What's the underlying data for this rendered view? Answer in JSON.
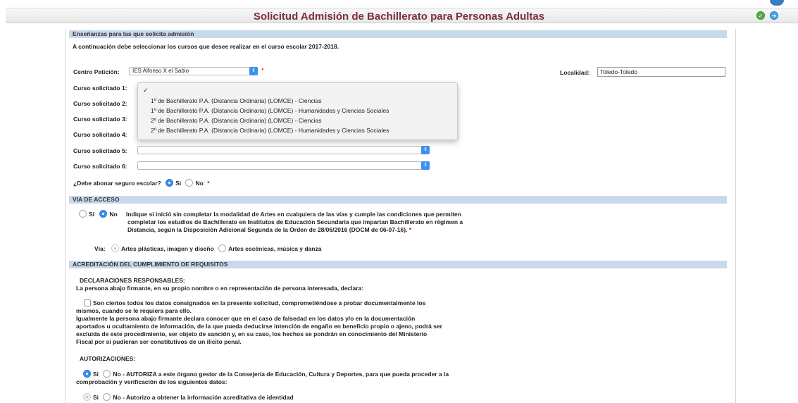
{
  "window": {
    "title": "Solicitud Admisión de Bachillerato para Personas Adultas",
    "icons": [
      "check-circle-icon",
      "arrow-circle-icon"
    ],
    "accent": "#7a2e3d"
  },
  "ensenanzas": {
    "header": "Enseñanzas para las que solicita admisión",
    "intro": "A continuación debe seleccionar los cursos que desee realizar en el curso escolar 2017-2018.",
    "centro_label": "Centro Petición:",
    "centro_value": "IES Alfonso X el Sabio",
    "required_mark": "*",
    "localidad_label": "Localidad:",
    "localidad_value": "Toledo-Toledo",
    "cursos": [
      {
        "label": "Curso solicitado 1:",
        "value": ""
      },
      {
        "label": "Curso solicitado 2:",
        "value": ""
      },
      {
        "label": "Curso solicitado 3:",
        "value": ""
      },
      {
        "label": "Curso solicitado 4:",
        "value": ""
      },
      {
        "label": "Curso solicitado 5:",
        "value": ""
      },
      {
        "label": "Curso solicitado 6:",
        "value": ""
      }
    ],
    "dropdown_options": [
      "1º de Bachillerato P.A. (Distancia Ordinaria) (LOMCE) - Ciencias",
      "1º de Bachillerato P.A. (Distancia Ordinaria) (LOMCE) - Humanidades y Ciencias Sociales",
      "2º de Bachillerato P.A. (Distancia Ordinaria) (LOMCE) - Ciencias",
      "2º de Bachillerato P.A. (Distancia Ordinaria) (LOMCE) - Humanidades y Ciencias Sociales"
    ],
    "seguro_label": "¿Debe abonar seguro escolar?",
    "si": "Si",
    "no": "No"
  },
  "via": {
    "header": "VIA DE ACCESO",
    "si": "Si",
    "no": "No",
    "text1": "Indique si inició sin completar la modalidad de Artes en cualquiera de las vías y cumple las condiciones que permiten",
    "text2": "completar los estudios de Bachillerato en Institutos de Educación Secundaria que impartan Bachillerato en régimen a",
    "text3": "Distancia, según la Disposición Adicional Segunda de la Orden de 28/06/2016 (DOCM de 06-07-16).",
    "via_label": "Vía:",
    "opt1": "Artes plásticas, imagen y diseño",
    "opt2": "Artes escénicas, música y danza"
  },
  "acreditacion": {
    "header": "ACREDITACIÓN DEL CUMPLIMIENTO DE REQUISITOS",
    "declaraciones": "DECLARACIONES RESPONSABLES:",
    "declara": "La persona abajo firmante, en su propio nombre o en representación de persona interesada, declara:",
    "check1": "Son ciertos todos los datos consignados en la presente solicitud, comprometiéndose a probar documentalmente los",
    "check1b": "mismos, cuando se le requiera para ello.",
    "p1": "Igualmente la persona abajo firmante declara conocer que en el caso de falsedad en los datos y/o en la documentación",
    "p2": "aportados u ocultamiento de información, de la que pueda deducirse intención de engaño en beneficio propio o ajeno, podrá ser",
    "p3": "excluida de este procedimiento, ser objeto de sanción y, en su caso, los hechos se pondrán en conocimiento del Ministerio",
    "p4": "Fiscal por si pudieran ser constitutivos de un ilícito penal.",
    "autorizaciones": "AUTORIZACIONES:",
    "si": "Si",
    "auth1": "No - AUTORIZA a este órgano gestor de la Consejería de Educación, Cultura y Deportes, para que pueda proceder a la",
    "auth1b": "comprobación y verificación de los siguientes datos:",
    "auth2": "No - Autorizo a obtener la información acreditativa de identidad"
  }
}
